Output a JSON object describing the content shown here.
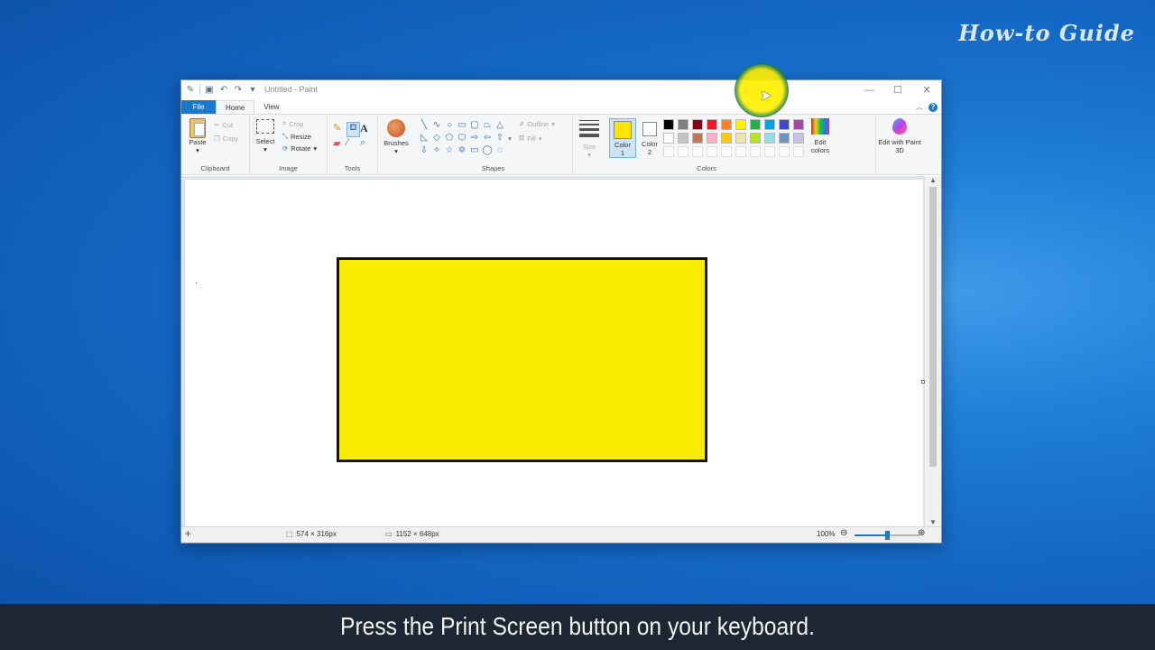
{
  "watermark": "How-to Guide",
  "window": {
    "title": "Untitled - Paint",
    "controls": {
      "minimize": "—",
      "maximize": "☐",
      "close": "✕"
    }
  },
  "qat_icons": [
    "paint-app-icon",
    "save-icon",
    "undo-icon",
    "redo-icon",
    "customize-dropdown-icon"
  ],
  "tabs": [
    {
      "label": "File"
    },
    {
      "label": "Home"
    },
    {
      "label": "View"
    }
  ],
  "ribbon": {
    "clipboard": {
      "group_label": "Clipboard",
      "paste": "Paste",
      "cut": "Cut",
      "copy": "Copy"
    },
    "image": {
      "group_label": "Image",
      "select": "Select",
      "crop": "Crop",
      "resize": "Resize",
      "rotate": "Rotate"
    },
    "tools": {
      "group_label": "Tools"
    },
    "brushes": {
      "label": "Brushes"
    },
    "shapes": {
      "group_label": "Shapes",
      "outline": "Outline",
      "fill": "Fill"
    },
    "size": {
      "label": "Size"
    },
    "colors": {
      "group_label": "Colors",
      "color1_label": "Color",
      "color1_num": "1",
      "color2_label": "Color",
      "color2_num": "2",
      "color1_value": "#ffe600",
      "color2_value": "#ffffff",
      "palette_row1": [
        "#000000",
        "#7f7f7f",
        "#880015",
        "#ed1c24",
        "#ff7f27",
        "#fff200",
        "#22b14c",
        "#00a2e8",
        "#3f48cc",
        "#a349a4"
      ],
      "palette_row2": [
        "#ffffff",
        "#c3c3c3",
        "#b97a57",
        "#ffaec9",
        "#ffc90e",
        "#efe4b0",
        "#b5e61d",
        "#99d9ea",
        "#7092be",
        "#c8bfe7"
      ],
      "edit_colors": "Edit colors",
      "edit_paint3d": "Edit with Paint 3D"
    }
  },
  "canvas": {
    "shape_fill": "#f7ec00",
    "shape_border": "#111111"
  },
  "status": {
    "selection_size": "574 × 316px",
    "image_size": "1152 × 648px",
    "zoom": "100%",
    "zoom_level_fraction": 0.5
  },
  "caption": "Press the Print Screen button on your keyboard."
}
